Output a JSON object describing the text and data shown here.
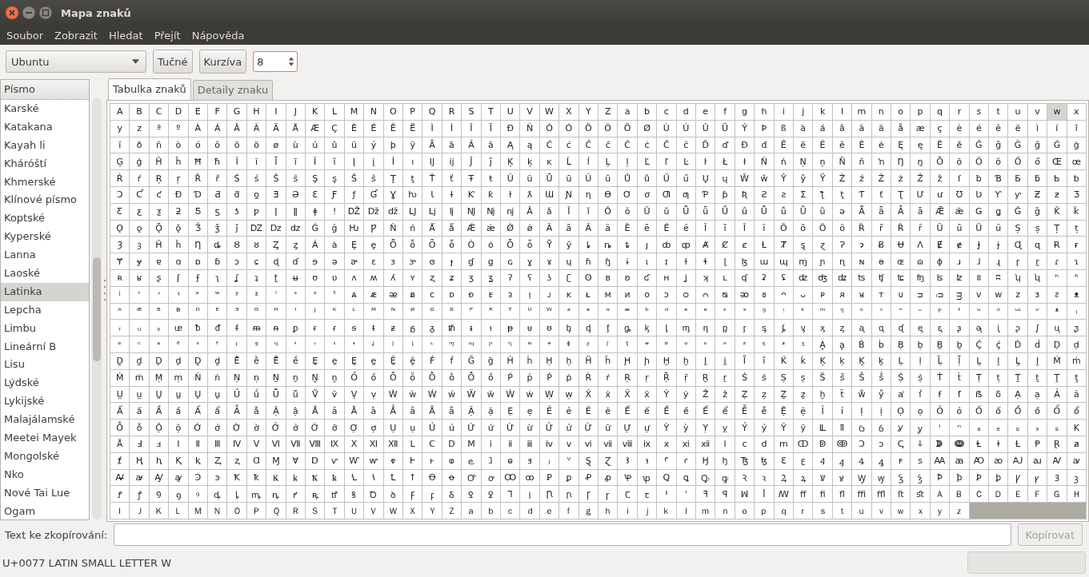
{
  "window": {
    "title": "Mapa znaků"
  },
  "menu": [
    "Soubor",
    "Zobrazit",
    "Hledat",
    "Přejít",
    "Nápověda"
  ],
  "toolbar": {
    "font": "Ubuntu",
    "buttons": [
      {
        "label": "Tučné",
        "pressed": false
      },
      {
        "label": "Kurzíva",
        "pressed": false
      }
    ],
    "size": "8"
  },
  "script_list": {
    "header": "Písmo",
    "items": [
      {
        "label": "Karské",
        "selected": false
      },
      {
        "label": "Katakana",
        "selected": false
      },
      {
        "label": "Kayah li",
        "selected": false
      },
      {
        "label": "Kháróští",
        "selected": false
      },
      {
        "label": "Khmerské",
        "selected": false
      },
      {
        "label": "Klínové písmo",
        "selected": false
      },
      {
        "label": "Koptské",
        "selected": false
      },
      {
        "label": "Kyperské",
        "selected": false
      },
      {
        "label": "Lanna",
        "selected": false
      },
      {
        "label": "Laoské",
        "selected": false
      },
      {
        "label": "Latinka",
        "selected": true
      },
      {
        "label": "Lepcha",
        "selected": false
      },
      {
        "label": "Limbu",
        "selected": false
      },
      {
        "label": "Lineární B",
        "selected": false
      },
      {
        "label": "Lisu",
        "selected": false
      },
      {
        "label": "Lýdské",
        "selected": false
      },
      {
        "label": "Lykijské",
        "selected": false
      },
      {
        "label": "Malajálamské",
        "selected": false
      },
      {
        "label": "Meetei Mayek",
        "selected": false
      },
      {
        "label": "Mongolské",
        "selected": false
      },
      {
        "label": "Nko",
        "selected": false
      },
      {
        "label": "Nové Tai Lue",
        "selected": false
      },
      {
        "label": "Ogam",
        "selected": false
      }
    ]
  },
  "tabs": [
    {
      "label": "Tabulka znaků",
      "selected": true
    },
    {
      "label": "Detaily znaku",
      "selected": false
    }
  ],
  "grid": {
    "rows": [
      [
        {
          "chars": "A B C D E F G H I J K L M N O P Q R S T U V W X Y Z a b c d e f g h i j k l m n o p q r s t u v",
          "selected": false
        },
        {
          "chars": "w",
          "selected": true
        },
        {
          "chars": "x",
          "selected": false
        }
      ],
      [
        {
          "chars": "y z ª º À Á Â Ã Ä Å Æ Ç È É Ê Ë Ì Í Î Ï Ð Ñ Ò Ó Ô Õ Ö Ø Ù Ú Û Ü Ý Þ ß à á â ã ä å æ ç è é ê ë ì í î",
          "selected": false
        }
      ],
      [
        {
          "chars": "ï ð ñ ò ó ô õ ö ø ù ú û ü ý þ ÿ Ā ā Ă ă Ą ą Ć ć Ĉ ĉ Ċ ċ Č č Ď ď Đ đ Ē ē Ĕ ĕ Ė ė Ę ę Ě ě Ĝ ĝ Ğ ğ Ġ ġ",
          "selected": false
        }
      ],
      [
        {
          "chars": "Ģ ģ Ĥ ĥ Ħ ħ Ĩ ĩ Ī ī Ĭ ĭ Į į İ ı Ĳ ĳ Ĵ ĵ Ķ ķ ĸ Ĺ ĺ Ļ ļ Ľ ľ Ŀ ŀ Ł ł Ń ń Ņ ņ Ň ň ŉ Ŋ ŋ Ō ō Ŏ ŏ Ő ő Œ œ",
          "selected": false
        }
      ],
      [
        {
          "chars": "Ŕ ŕ Ŗ ŗ Ř ř Ś ś Ŝ ŝ Ş ş Š š Ţ ţ Ť ť Ŧ ŧ Ũ ũ Ū ū Ŭ ŭ Ů ů Ű ű Ų ų Ŵ ŵ Ŷ ŷ Ÿ Ź ź Ż ż Ž ž ſ ƀ Ɓ Ƃ ƃ Ƅ ƅ",
          "selected": false
        }
      ],
      [
        {
          "chars": "Ɔ Ƈ ƈ Ɖ Ɗ Ƌ ƌ ƍ Ǝ Ə Ɛ Ƒ ƒ Ɠ Ɣ ƕ Ɩ Ɨ Ƙ ƙ ƚ ƛ Ɯ Ɲ ƞ Ɵ Ơ ơ Ƣ ƣ Ƥ ƥ Ʀ Ƨ ƨ Ʃ ƪ ƫ Ƭ ƭ Ʈ Ư ư Ʊ Ʋ Ƴ ƴ Ƶ ƶ Ʒ",
          "selected": false
        }
      ],
      [
        {
          "chars": "Ƹ ƹ ƺ ƻ Ƽ ƽ ƾ ƿ ǀ ǁ ǂ ǃ Ǆ ǅ ǆ Ǉ ǈ ǉ Ǌ ǋ ǌ Ǎ ǎ Ǐ ǐ Ǒ ǒ Ǔ ǔ Ǖ ǖ Ǘ ǘ Ǚ ǚ Ǜ ǜ ǝ Ǟ ǟ Ǡ ǡ Ǣ ǣ Ǥ ǥ Ǧ ǧ Ǩ ǩ",
          "selected": false
        }
      ],
      [
        {
          "chars": "Ǫ ǫ Ǭ ǭ Ǯ ǯ ǰ Ǳ ǲ ǳ Ǵ ǵ Ƕ Ƿ Ǹ ǹ Ǻ ǻ Ǽ ǽ Ǿ ǿ Ȁ ȁ Ȃ ȃ Ȅ ȅ Ȇ ȇ Ȉ ȉ Ȋ ȋ Ȍ ȍ Ȏ ȏ Ȑ ȑ Ȓ ȓ Ȕ ȕ Ȗ ȗ Ș ș Ț ț",
          "selected": false
        }
      ],
      [
        {
          "chars": "Ȝ ȝ Ȟ ȟ Ƞ ȡ Ȣ ȣ Ȥ ȥ Ȧ ȧ Ȩ ȩ Ȫ ȫ Ȭ ȭ Ȯ ȯ Ȱ ȱ Ȳ ȳ ȴ ȵ ȶ ȷ ȸ ȹ Ⱥ Ȼ ȼ Ƚ Ⱦ ȿ ɀ Ɂ ɂ Ƀ Ʉ Ʌ Ɇ ɇ Ɉ ɉ Ɋ ɋ Ɍ ɍ",
          "selected": false
        }
      ],
      [
        {
          "chars": "Ɏ ɏ ɐ ɑ ɒ ɓ ɔ ɕ ɖ ɗ ɘ ə ɚ ɛ ɜ ɝ ɞ ɟ ɠ ɡ ɢ ɣ ɤ ɥ ɦ ɧ ɨ ɩ ɪ ɫ ɬ ɭ ɮ ɯ ɰ ɱ ɲ ɳ ɴ ɵ ɶ ɷ ɸ ɹ ɺ ɻ ɼ ɽ ɾ ɿ",
          "selected": false
        }
      ],
      [
        {
          "chars": "ʀ ʁ ʂ ʃ ʄ ʅ ʆ ʇ ʈ ʉ ʊ ʋ ʌ ʍ ʎ ʏ ʐ ʑ ʒ ʓ ʔ ʕ ʖ ʗ ʘ ʙ ʚ ʛ ʜ ʝ ʞ ʟ ʠ ʡ ʢ ʣ ʤ ʥ ʦ ʧ ʨ ʩ ʪ ʫ ʬ ʭ ʮ ʯ ʰ ʱ",
          "selected": false
        }
      ],
      [
        {
          "chars": "ʲ ʳ ʴ ʵ ʶ ʷ ʸ ˠ ˡ ˢ ˣ ˤ ᴀ ᴁ ᴂ ᴃ ᴄ ᴅ ᴆ ᴇ ᴈ ᴉ ᴊ ᴋ ᴌ ᴍ ᴎ ᴏ ᴐ ᴑ ᴒ ᴓ ᴔ ᴕ ᴖ ᴗ ᴘ ᴙ ᴚ ᴛ ᴜ ᴝ ᴞ ᴟ ᴠ ᴡ ᴢ ᴣ ᴤ ᴥ",
          "selected": false
        }
      ],
      [
        {
          "chars": "ᴬ ᴭ ᴮ ᴯ ᴰ ᴱ ᴲ ᴳ ᴴ ᴵ ᴶ ᴷ ᴸ ᴹ ᴺ ᴻ ᴼ ᴽ ᴾ ᴿ ᵀ ᵁ ᵂ ᵃ ᵄ ᵅ ᵆ ᵇ ᵈ ᵉ ᵊ ᵋ ᵌ ᵍ ᵎ ᵏ ᵐ ᵑ ᵒ ᵓ ᵔ ᵕ ᵖ ᵗ ᵘ ᵙ ᵚ ᵛ ᵜ ᵢ",
          "selected": false
        }
      ],
      [
        {
          "chars": "ᵣ ᵤ ᵥ ᵫ ᵬ ᵭ ᵮ ᵯ ᵰ ᵱ ᵲ ᵳ ᵴ ᵵ ᵶ ᵷ ᵹ ᵺ ᵻ ᵼ ᵽ ᵾ ᵿ ᶀ ᶁ ᶂ ᶃ ᶄ ᶅ ᶆ ᶇ ᶈ ᶉ ᶊ ᶋ ᶌ ᶍ ᶎ ᶏ ᶐ ᶑ ᶒ ᶓ ᶔ ᶕ ᶖ ᶗ ᶘ ᶙ ᶚ",
          "selected": false
        }
      ],
      [
        {
          "chars": "ᶛ ᶜ ᶝ ᶞ ᶟ ᶠ ᶡ ᶢ ᶣ ᶤ ᶥ ᶦ ᶧ ᶨ ᶩ ᶪ ᶫ ᶬ ᶭ ᶮ ᶯ ᶰ ᶱ ᶲ ᶳ ᶴ ᶵ ᶶ ᶷ ᶸ ᶹ ᶺ ᶻ ᶼ ᶽ ᶾ Ḁ ḁ Ḃ ḃ Ḅ ḅ Ḇ ḇ Ḉ ḉ Ḋ ḋ Ḍ ḍ",
          "selected": false
        }
      ],
      [
        {
          "chars": "Ḏ ḏ Ḑ ḑ Ḓ ḓ Ḕ ḕ Ḗ ḗ Ḙ ḙ Ḛ ḛ Ḝ ḝ Ḟ ḟ Ḡ ḡ Ḣ ḣ Ḥ ḥ Ḧ ḧ Ḩ ḩ Ḫ ḫ Ḭ ḭ Ḯ ḯ Ḱ ḱ Ḳ ḳ Ḵ ḵ Ḷ ḷ Ḹ ḹ Ḻ ḻ Ḽ ḽ Ḿ ḿ",
          "selected": false
        }
      ],
      [
        {
          "chars": "Ṁ ṁ Ṃ ṃ Ṅ ṅ Ṇ ṇ Ṉ ṉ Ṋ ṋ Ṍ ṍ Ṏ ṏ Ṑ ṑ Ṓ ṓ Ṕ ṕ Ṗ ṗ Ṙ ṙ Ṛ ṛ Ṝ ṝ Ṟ ṟ Ṡ ṡ Ṣ ṣ Ṥ ṥ Ṧ ṧ Ṩ ṩ Ṫ ṫ Ṭ ṭ Ṯ ṯ Ṱ ṱ",
          "selected": false
        }
      ],
      [
        {
          "chars": "Ṳ ṳ Ṵ ṵ Ṷ ṷ Ṹ ṹ Ṻ ṻ Ṽ ṽ Ṿ ṿ Ẁ ẁ Ẃ ẃ Ẅ ẅ Ẇ ẇ Ẉ ẉ Ẋ ẋ Ẍ ẍ Ẏ ẏ Ẑ ẑ Ẓ ẓ Ẕ ẕ ẖ ẗ ẘ ẙ ẚ ẛ ẜ ẝ ẞ ẟ Ạ ạ Ả ả",
          "selected": false
        }
      ],
      [
        {
          "chars": "Ấ ấ Ầ ầ Ẩ ẩ Ẫ ẫ Ậ ậ Ắ ắ Ằ ằ Ẳ ẳ Ẵ ẵ Ặ ặ Ẹ ẹ Ẻ ẻ Ẽ ẽ Ế ế Ề ề Ể ể Ễ ễ Ệ ệ Ỉ ỉ Ị ị Ọ ọ Ỏ ỏ Ố ố Ồ ồ Ổ ổ",
          "selected": false
        }
      ],
      [
        {
          "chars": "Ỗ ỗ Ộ ộ Ớ ớ Ờ ờ Ở ở Ỡ ỡ Ợ ợ Ụ ụ Ủ ủ Ứ ứ Ừ ừ Ử ử Ữ ữ Ự ự Ỳ ỳ Ỵ ỵ Ỷ ỷ Ỹ ỹ Ỻ ỻ Ỽ ỽ Ỿ ỿ ⁱ ⁿ ₐ ₑ ₒ ₓ ₔ K",
          "selected": false
        }
      ],
      [
        {
          "chars": "Å Ⅎ ⅎ Ⅰ Ⅱ Ⅲ Ⅳ Ⅴ Ⅵ Ⅶ Ⅷ Ⅸ Ⅹ Ⅺ Ⅻ Ⅼ Ⅽ Ⅾ Ⅿ ⅰ ⅱ ⅲ ⅳ ⅴ ⅵ ⅶ ⅷ ⅸ ⅹ ⅺ ⅻ ⅼ ⅽ ⅾ ⅿ ↀ ↁ ↂ Ↄ ↄ ↅ ↆ ↇ ↈ Ⱡ ⱡ Ɫ Ᵽ Ɽ ⱥ",
          "selected": false
        }
      ],
      [
        {
          "chars": "ⱦ Ⱨ ⱨ Ⱪ ⱪ Ⱬ ⱬ Ɑ Ɱ Ɐ Ɒ ⱱ Ⱳ ⱳ ⱴ Ⱶ ⱶ ⱷ ⱸ ⱹ ⱺ ⱻ ⱼ ⱽ Ȿ Ɀ Ꜣ ꜣ Ꜥ ꜥ Ꜧ ꜧ Ꜩ ꜩ Ꜫ ꜫ Ꜭ ꜭ Ꜯ ꜯ ꜰ ꜱ Ꜳ ꜳ Ꜵ ꜵ Ꜷ ꜷ Ꜹ ꜹ",
          "selected": false
        }
      ],
      [
        {
          "chars": "Ꜻ ꜻ Ꜽ ꜽ Ꜿ ꜿ Ꝁ ꝁ Ꝃ ꝃ Ꝅ ꝅ Ꝇ ꝇ Ꝉ ꝉ Ꝋ ꝋ Ꝍ ꝍ Ꝏ ꝏ Ꝑ ꝑ Ꝓ ꝓ Ꝕ ꝕ Ꝗ ꝗ Ꝙ ꝙ Ꝛ ꝛ Ꝝ ꝝ Ꝟ ꝟ Ꝡ ꝡ Ꝣ ꝣ Ꝥ ꝥ Ꝧ ꝧ Ꝩ ꝩ Ꝫ ꝫ",
          "selected": false
        }
      ],
      [
        {
          "chars": "Ꝭ ꝭ Ꝯ ꝯ ꝰ ꝱ ꝲ ꝳ ꝴ ꝵ ꝶ ꝷ ꝸ Ꝺ ꝺ Ꝼ ꝼ Ᵹ Ꝿ ꝿ Ꞁ ꞁ Ꞃ ꞃ Ꞅ ꞅ Ꞇ ꞇ Ꞌ ꞌ ꟻ ꟼ ꟽ ꟾ ꟿ ﬀ ﬁ ﬂ ﬃ ﬄ ﬅ ﬆ Ａ Ｂ Ｃ Ｄ Ｅ Ｆ Ｇ Ｈ",
          "selected": false
        }
      ],
      [
        {
          "chars": "Ｉ Ｊ Ｋ Ｌ Ｍ Ｎ Ｏ Ｐ Ｑ Ｒ Ｓ Ｔ Ｕ Ｖ Ｗ Ｘ Ｙ Ｚ ａ ｂ ｃ ｄ ｅ ｆ ｇ ｈ ｉ ｊ ｋ ｌ ｍ ｎ ｏ ｐ ｑ ｒ ｓ ｔ ｕ ｖ ｗ ｘ ｙ ｚ",
          "selected": false
        }
      ]
    ]
  },
  "copy": {
    "label": "Text ke zkopírování:",
    "button": {
      "label": "Kopírovat",
      "disabled": true
    }
  },
  "status_bar": "U+0077 LATIN SMALL LETTER W"
}
